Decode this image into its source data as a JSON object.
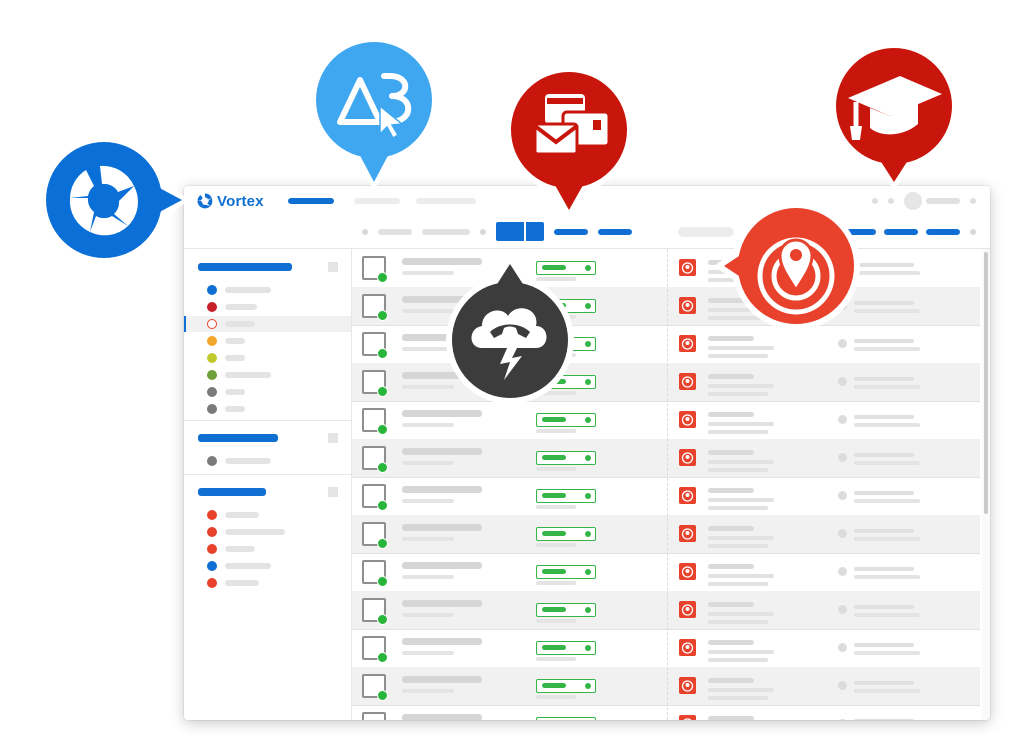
{
  "app": {
    "name": "Vortex",
    "brand_color": "#0f6fd2"
  },
  "colors": {
    "status_green": "#35b548",
    "location_red": "#e8412c",
    "bubble_blue_dark": "#0a6fd6",
    "bubble_blue_light": "#3fa7f0",
    "bubble_red": "#c8160c",
    "bubble_dark": "#3c3c3c"
  },
  "sidebar": {
    "groups": [
      {
        "items": [
          {
            "icon": "dot",
            "color": "#0f6fd2"
          },
          {
            "icon": "dot",
            "color": "#c8202a"
          },
          {
            "icon": "location-icon",
            "color": "#e8412c",
            "active": true
          },
          {
            "icon": "dot",
            "color": "#f2a72a"
          },
          {
            "icon": "dot",
            "color": "#c2c92d"
          },
          {
            "icon": "dot",
            "color": "#6fa03a"
          },
          {
            "icon": "dot",
            "color": "#7a7a7a"
          },
          {
            "icon": "dot",
            "color": "#7a7a7a"
          }
        ]
      },
      {
        "items": [
          {
            "icon": "dot",
            "color": "#7a7a7a"
          }
        ]
      },
      {
        "items": [
          {
            "icon": "dot",
            "color": "#e8412c"
          },
          {
            "icon": "dot",
            "color": "#e8412c"
          },
          {
            "icon": "dot",
            "color": "#e8412c"
          },
          {
            "icon": "dot",
            "color": "#0f6fd2"
          },
          {
            "icon": "dot",
            "color": "#e8412c"
          }
        ]
      }
    ]
  },
  "table": {
    "row_count": 13,
    "row_status": "online",
    "row_icon": "location-icon"
  },
  "feature_bubbles": [
    {
      "icon": "vortex-logo-icon",
      "color": "#0a6fd6"
    },
    {
      "icon": "ab-test-cursor-icon",
      "color": "#3fa7f0"
    },
    {
      "icon": "messaging-icon",
      "color": "#c8160c"
    },
    {
      "icon": "graduation-cap-icon",
      "color": "#c8160c"
    },
    {
      "icon": "cloud-phone-icon",
      "color": "#3c3c3c"
    },
    {
      "icon": "geofence-location-icon",
      "color": "#e8412c"
    }
  ]
}
